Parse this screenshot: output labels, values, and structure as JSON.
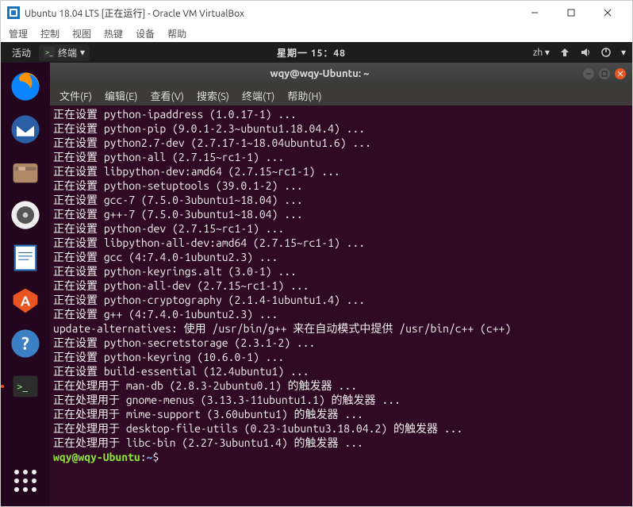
{
  "vb": {
    "title": "Ubuntu 18.04 LTS [正在运行] - Oracle VM VirtualBox",
    "menus": [
      "管理",
      "控制",
      "视图",
      "热键",
      "设备",
      "帮助"
    ]
  },
  "ubuntu_top": {
    "activities": "活动",
    "app_label": "终端",
    "clock": "星期一 15：48",
    "lang": "zh"
  },
  "terminal": {
    "title": "wqy@wqy-Ubuntu: ~",
    "menus": [
      "文件(F)",
      "编辑(E)",
      "查看(V)",
      "搜索(S)",
      "终端(T)",
      "帮助(H)"
    ],
    "lines": [
      "正在设置 python-ipaddress (1.0.17-1) ...",
      "正在设置 python-pip (9.0.1-2.3~ubuntu1.18.04.4) ...",
      "正在设置 python2.7-dev (2.7.17-1~18.04ubuntu1.6) ...",
      "正在设置 python-all (2.7.15~rc1-1) ...",
      "正在设置 libpython-dev:amd64 (2.7.15~rc1-1) ...",
      "正在设置 python-setuptools (39.0.1-2) ...",
      "正在设置 gcc-7 (7.5.0-3ubuntu1~18.04) ...",
      "正在设置 g++-7 (7.5.0-3ubuntu1~18.04) ...",
      "正在设置 python-dev (2.7.15~rc1-1) ...",
      "正在设置 libpython-all-dev:amd64 (2.7.15~rc1-1) ...",
      "正在设置 gcc (4:7.4.0-1ubuntu2.3) ...",
      "正在设置 python-keyrings.alt (3.0-1) ...",
      "正在设置 python-all-dev (2.7.15~rc1-1) ...",
      "正在设置 python-cryptography (2.1.4-1ubuntu1.4) ...",
      "正在设置 g++ (4:7.4.0-1ubuntu2.3) ...",
      "update-alternatives: 使用 /usr/bin/g++ 来在自动模式中提供 /usr/bin/c++ (c++)",
      "正在设置 python-secretstorage (2.3.1-2) ...",
      "正在设置 python-keyring (10.6.0-1) ...",
      "正在设置 build-essential (12.4ubuntu1) ...",
      "正在处理用于 man-db (2.8.3-2ubuntu0.1) 的触发器 ...",
      "正在处理用于 gnome-menus (3.13.3-11ubuntu1.1) 的触发器 ...",
      "正在处理用于 mime-support (3.60ubuntu1) 的触发器 ...",
      "正在处理用于 desktop-file-utils (0.23-1ubuntu3.18.04.2) 的触发器 ...",
      "正在处理用于 libc-bin (2.27-3ubuntu1.4) 的触发器 ..."
    ],
    "prompt_user": "wqy@wqy-Ubuntu",
    "prompt_path": "~",
    "prompt_symbol": "$"
  },
  "launcher_items": [
    {
      "name": "firefox",
      "bg": "#e66000"
    },
    {
      "name": "thunderbird",
      "bg": "#1f6fd0"
    },
    {
      "name": "files",
      "bg": "#8a6a4a"
    },
    {
      "name": "rhythmbox",
      "bg": "#dcdcdc"
    },
    {
      "name": "libreoffice-writer",
      "bg": "#2a6fb0"
    },
    {
      "name": "ubuntu-software",
      "bg": "#e95420"
    },
    {
      "name": "help",
      "bg": "#3b7fc4"
    },
    {
      "name": "terminal",
      "bg": "#2d2d2d"
    }
  ]
}
